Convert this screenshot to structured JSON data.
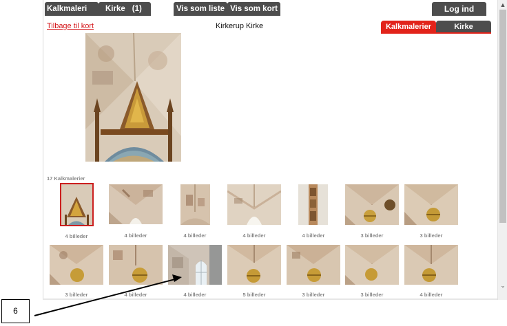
{
  "topbar": {
    "kalkmaleri_label": "Kalkmaleri",
    "kirke_label": "Kirke",
    "kirke_count": "(1)",
    "list_view_label": "Vis som liste",
    "map_view_label": "Vis som kort",
    "login_label": "Log ind"
  },
  "header": {
    "back_link": "Tilbage til kort",
    "church_name": "Kirkerup Kirke",
    "tabs": [
      {
        "label": "Kalkmalerier",
        "active": true
      },
      {
        "label": "Kirke",
        "active": false
      }
    ]
  },
  "gallery": {
    "title": "17 Kalkmalerier",
    "row1": [
      {
        "caption": "4 billeder"
      },
      {
        "caption": "4 billeder"
      },
      {
        "caption": "4 billeder"
      },
      {
        "caption": "4 billeder"
      },
      {
        "caption": "4 billeder"
      },
      {
        "caption": "3 billeder"
      },
      {
        "caption": "3 billeder"
      }
    ],
    "row2": [
      {
        "caption": "3 billeder"
      },
      {
        "caption": "4 billeder"
      },
      {
        "caption": "4 billeder"
      },
      {
        "caption": "5 billeder"
      },
      {
        "caption": "3 billeder"
      },
      {
        "caption": "3 billeder"
      },
      {
        "caption": "4 billeder"
      }
    ]
  },
  "annotation": {
    "label": "6"
  },
  "colors": {
    "accent_red": "#e2231a",
    "tab_dark": "#4d4d4d",
    "link_red": "#d4181c"
  },
  "icons": {
    "scroll_up": "chevron-up-icon",
    "scroll_down": "chevron-down-icon"
  }
}
